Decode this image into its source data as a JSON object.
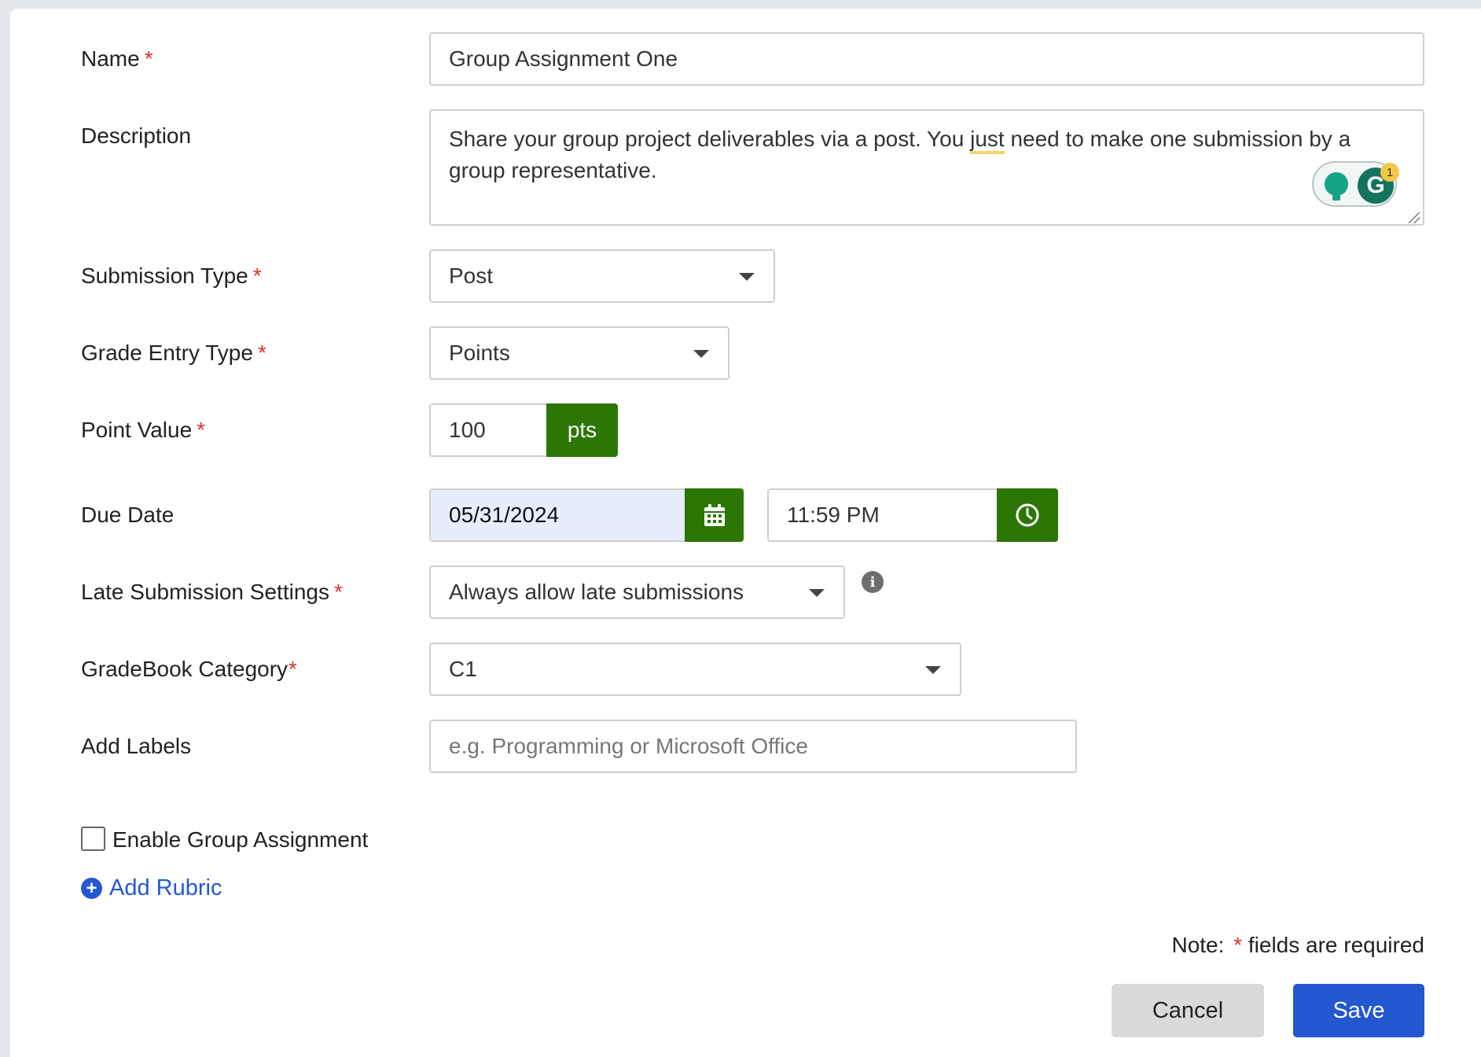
{
  "form": {
    "name": {
      "label": "Name",
      "required_mark": "*",
      "value": "Group Assignment One"
    },
    "description": {
      "label": "Description",
      "value_before": "Share your group project deliverables via a post. You ",
      "value_highlight": "just",
      "value_after": " need to make one submission by a group representative.",
      "grammarly_badge_count": "1"
    },
    "submission_type": {
      "label": "Submission Type",
      "required_mark": "*",
      "value": "Post"
    },
    "grade_entry_type": {
      "label": "Grade Entry Type",
      "required_mark": "*",
      "value": "Points"
    },
    "point_value": {
      "label": "Point Value",
      "required_mark": "*",
      "value": "100",
      "unit": "pts"
    },
    "due_date": {
      "label": "Due Date",
      "date": "05/31/2024",
      "time": "11:59 PM"
    },
    "late_submission": {
      "label": "Late Submission Settings",
      "required_mark": "*",
      "value": "Always allow late submissions",
      "info_icon_glyph": "i"
    },
    "gradebook_category": {
      "label": "GradeBook Category",
      "required_mark": "*",
      "value": "C1"
    },
    "labels": {
      "label": "Add Labels",
      "placeholder": "e.g. Programming or Microsoft Office"
    },
    "enable_group": {
      "label": "Enable Group Assignment",
      "checked": false
    },
    "add_rubric": {
      "label": "Add Rubric"
    }
  },
  "footer": {
    "note_prefix": "Note:",
    "note_mark": "*",
    "note_suffix": "fields are required",
    "cancel_label": "Cancel",
    "save_label": "Save"
  },
  "icons": {
    "calendar": "calendar-icon",
    "clock": "clock-icon",
    "info": "info-icon",
    "plus": "plus-circle-icon",
    "caret": "caret-down-icon",
    "grammarly": "grammarly-icon"
  },
  "colors": {
    "accent_green": "#2c7606",
    "primary_blue": "#2458d0",
    "required_red": "#d9352b"
  }
}
